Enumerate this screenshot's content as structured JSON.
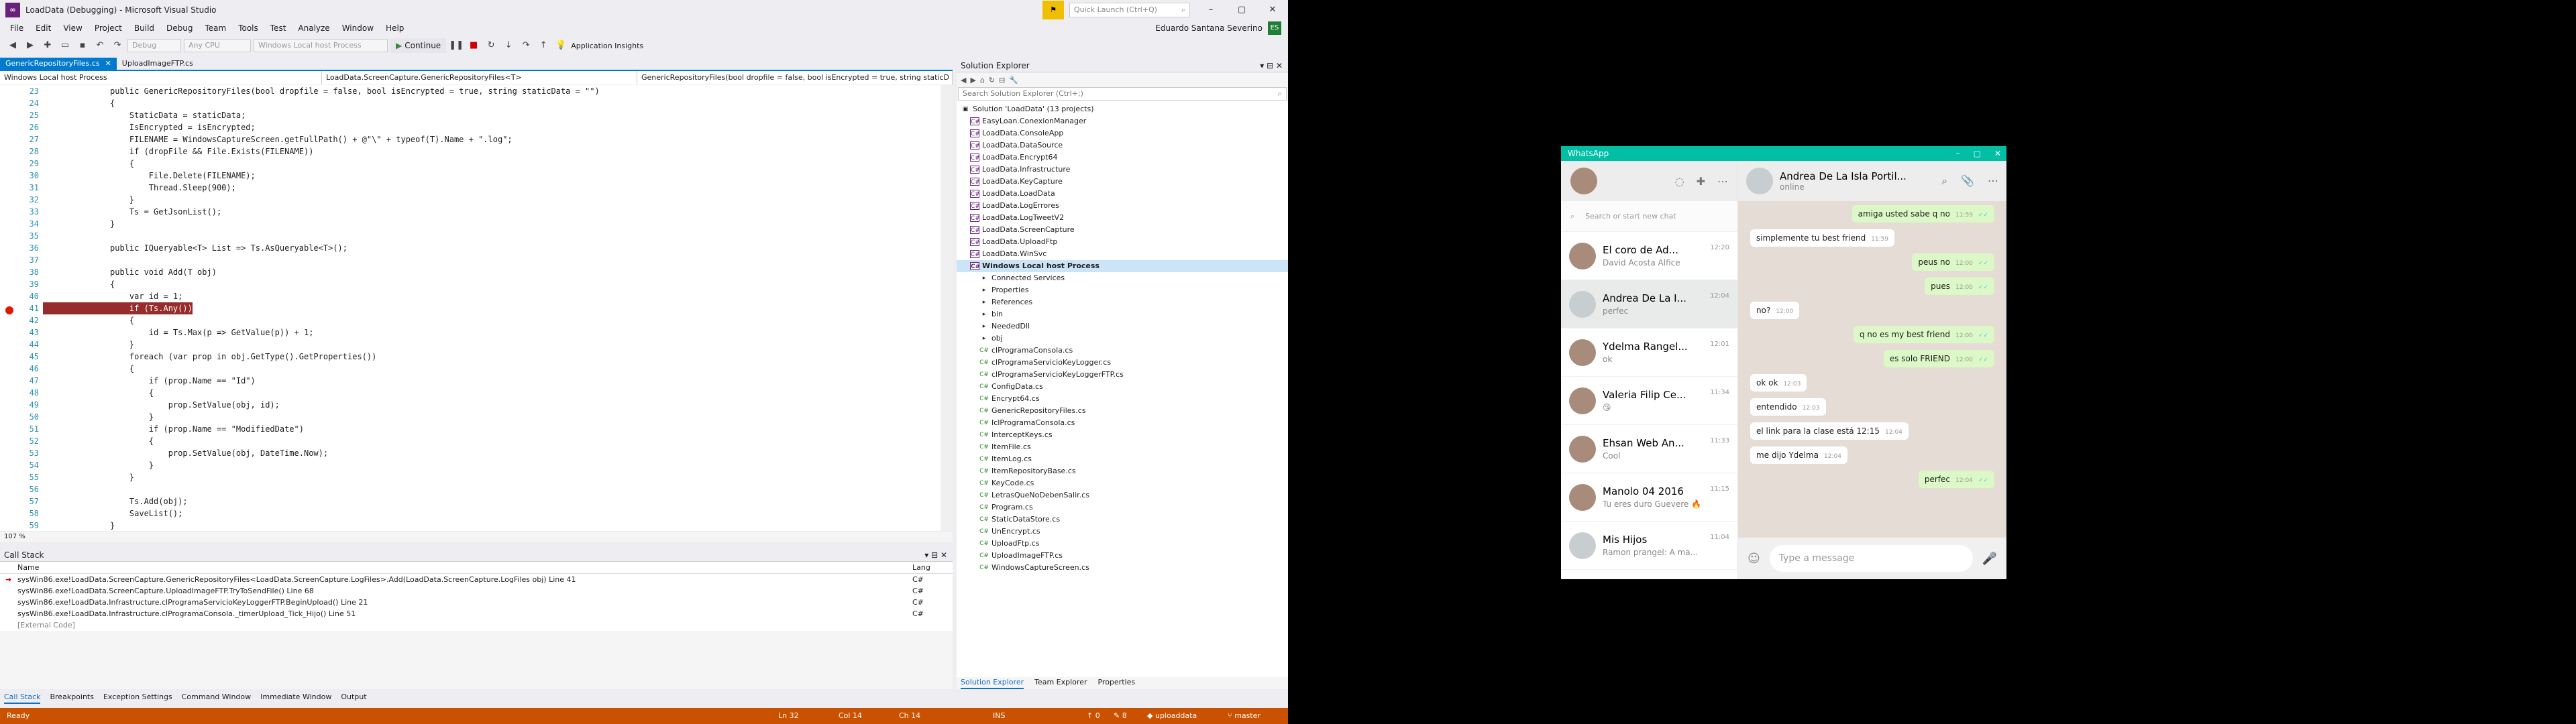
{
  "vs": {
    "title": "LoadData (Debugging) - Microsoft Visual Studio",
    "quick_launch": "Quick Launch (Ctrl+Q)",
    "account": "Eduardo Santana Severino",
    "account_initials": "ES",
    "menu": [
      "File",
      "Edit",
      "View",
      "Project",
      "Build",
      "Debug",
      "Team",
      "Tools",
      "Test",
      "Analyze",
      "Window",
      "Help"
    ],
    "toolbar": {
      "config": "Debug",
      "platform": "Any CPU",
      "process": "Windows Local host Process",
      "continue": "Continue",
      "app_insights": "Application Insights"
    },
    "tabs": [
      {
        "label": "GenericRepositoryFiles.cs"
      },
      {
        "label": "UploadImageFTP.cs"
      }
    ],
    "nav": {
      "project": "Windows Local host Process",
      "class": "LoadData.ScreenCapture.GenericRepositoryFiles<T>",
      "member": "GenericRepositoryFiles(bool dropfile = false, bool isEncrypted = true, string staticD"
    },
    "zoom": "107 %",
    "code": [
      {
        "n": "23",
        "t": "public GenericRepositoryFiles(bool dropfile = false, bool isEncrypted = true, string staticData = \"\")"
      },
      {
        "n": "24",
        "t": "{"
      },
      {
        "n": "25",
        "t": "    StaticData = staticData;"
      },
      {
        "n": "26",
        "t": "    IsEncrypted = isEncrypted;"
      },
      {
        "n": "27",
        "t": "    FILENAME = WindowsCaptureScreen.getFullPath() + @\"\\\" + typeof(T).Name + \".log\";"
      },
      {
        "n": "28",
        "t": "    if (dropFile && File.Exists(FILENAME))"
      },
      {
        "n": "29",
        "t": "    {"
      },
      {
        "n": "30",
        "t": "        File.Delete(FILENAME);"
      },
      {
        "n": "31",
        "t": "        Thread.Sleep(900);"
      },
      {
        "n": "32",
        "t": "    }"
      },
      {
        "n": "33",
        "t": "    Ts = GetJsonList();"
      },
      {
        "n": "34",
        "t": "}"
      },
      {
        "n": "35",
        "t": ""
      },
      {
        "n": "36",
        "t": "public IQueryable<T> List => Ts.AsQueryable<T>();"
      },
      {
        "n": "37",
        "t": ""
      },
      {
        "n": "38",
        "t": "public void Add(T obj)"
      },
      {
        "n": "39",
        "t": "{"
      },
      {
        "n": "40",
        "t": "    var id = 1;"
      },
      {
        "n": "41",
        "t": "    if (Ts.Any())"
      },
      {
        "n": "42",
        "t": "    {"
      },
      {
        "n": "43",
        "t": "        id = Ts.Max(p => GetValue(p)) + 1;"
      },
      {
        "n": "44",
        "t": "    }"
      },
      {
        "n": "45",
        "t": "    foreach (var prop in obj.GetType().GetProperties())"
      },
      {
        "n": "46",
        "t": "    {"
      },
      {
        "n": "47",
        "t": "        if (prop.Name == \"Id\")"
      },
      {
        "n": "48",
        "t": "        {"
      },
      {
        "n": "49",
        "t": "            prop.SetValue(obj, id);"
      },
      {
        "n": "50",
        "t": "        }"
      },
      {
        "n": "51",
        "t": "        if (prop.Name == \"ModifiedDate\")"
      },
      {
        "n": "52",
        "t": "        {"
      },
      {
        "n": "53",
        "t": "            prop.SetValue(obj, DateTime.Now);"
      },
      {
        "n": "54",
        "t": "        }"
      },
      {
        "n": "55",
        "t": "    }"
      },
      {
        "n": "56",
        "t": ""
      },
      {
        "n": "57",
        "t": "    Ts.Add(obj);"
      },
      {
        "n": "58",
        "t": "    SaveList();"
      },
      {
        "n": "59",
        "t": "}"
      }
    ],
    "callstack": {
      "title": "Call Stack",
      "col_name": "Name",
      "col_lang": "Lang",
      "rows": [
        {
          "name": "sysWin86.exe!LoadData.ScreenCapture.GenericRepositoryFiles<LoadData.ScreenCapture.LogFiles>.Add(LoadData.ScreenCapture.LogFiles obj) Line 41",
          "lang": "C#"
        },
        {
          "name": "sysWin86.exe!LoadData.ScreenCapture.UploadImageFTP.TryToSendFile() Line 68",
          "lang": "C#"
        },
        {
          "name": "sysWin86.exe!LoadData.Infrastructure.clProgramaServicioKeyLoggerFTP.BeginUpload() Line 21",
          "lang": "C#"
        },
        {
          "name": "sysWin86.exe!LoadData.Infrastructure.clProgramaConsola._timerUpload_Tick_Hijo() Line 51",
          "lang": "C#"
        },
        {
          "name": "[External Code]",
          "lang": ""
        }
      ]
    },
    "bottom_tabs": [
      "Call Stack",
      "Breakpoints",
      "Exception Settings",
      "Command Window",
      "Immediate Window",
      "Output"
    ],
    "solution_explorer": {
      "title": "Solution Explorer",
      "search": "Search Solution Explorer (Ctrl+;)",
      "items": [
        {
          "label": "Solution 'LoadData' (13 projects)",
          "kind": "sol"
        },
        {
          "label": "EasyLoan.ConexionManager",
          "kind": "proj"
        },
        {
          "label": "LoadData.ConsoleApp",
          "kind": "proj"
        },
        {
          "label": "LoadData.DataSource",
          "kind": "proj"
        },
        {
          "label": "LoadData.Encrypt64",
          "kind": "proj"
        },
        {
          "label": "LoadData.Infrastructure",
          "kind": "proj"
        },
        {
          "label": "LoadData.KeyCapture",
          "kind": "proj"
        },
        {
          "label": "LoadData.LoadData",
          "kind": "proj"
        },
        {
          "label": "LoadData.LogErrores",
          "kind": "proj"
        },
        {
          "label": "LoadData.LogTweetV2",
          "kind": "proj"
        },
        {
          "label": "LoadData.ScreenCapture",
          "kind": "proj"
        },
        {
          "label": "LoadData.UploadFtp",
          "kind": "proj"
        },
        {
          "label": "LoadData.WinSvc",
          "kind": "proj"
        },
        {
          "label": "Windows Local host Process",
          "kind": "sel"
        },
        {
          "label": "Connected Services",
          "kind": "node"
        },
        {
          "label": "Properties",
          "kind": "node"
        },
        {
          "label": "References",
          "kind": "node"
        },
        {
          "label": "bin",
          "kind": "node"
        },
        {
          "label": "NeededDll",
          "kind": "node"
        },
        {
          "label": "obj",
          "kind": "node"
        },
        {
          "label": "clProgramaConsola.cs",
          "kind": "file"
        },
        {
          "label": "clProgramaServicioKeyLogger.cs",
          "kind": "file"
        },
        {
          "label": "clProgramaServicioKeyLoggerFTP.cs",
          "kind": "file"
        },
        {
          "label": "ConfigData.cs",
          "kind": "file"
        },
        {
          "label": "Encrypt64.cs",
          "kind": "file"
        },
        {
          "label": "GenericRepositoryFiles.cs",
          "kind": "file"
        },
        {
          "label": "IclProgramaConsola.cs",
          "kind": "file"
        },
        {
          "label": "InterceptKeys.cs",
          "kind": "file"
        },
        {
          "label": "ItemFile.cs",
          "kind": "file"
        },
        {
          "label": "ItemLog.cs",
          "kind": "file"
        },
        {
          "label": "ItemRepositoryBase.cs",
          "kind": "file"
        },
        {
          "label": "KeyCode.cs",
          "kind": "file"
        },
        {
          "label": "LetrasQueNoDebenSalir.cs",
          "kind": "file"
        },
        {
          "label": "Program.cs",
          "kind": "file"
        },
        {
          "label": "StaticDataStore.cs",
          "kind": "file"
        },
        {
          "label": "UnEncrypt.cs",
          "kind": "file"
        },
        {
          "label": "UploadFtp.cs",
          "kind": "file"
        },
        {
          "label": "UploadImageFTP.cs",
          "kind": "file"
        },
        {
          "label": "WindowsCaptureScreen.cs",
          "kind": "file"
        }
      ],
      "tabs": [
        "Solution Explorer",
        "Team Explorer",
        "Properties"
      ]
    },
    "status": {
      "ready": "Ready",
      "ln": "Ln 32",
      "col": "Col 14",
      "ch": "Ch 14",
      "ins": "INS",
      "up": "0",
      "pen": "8",
      "repo": "uploaddata",
      "branch": "master"
    }
  },
  "whatsapp": {
    "title": "WhatsApp",
    "search_placeholder": "Search or start new chat",
    "chats": [
      {
        "name": "El coro de Ad...",
        "time": "12:20",
        "preview": "David Acosta Alfice"
      },
      {
        "name": "Andrea De La I...",
        "time": "12:04",
        "preview": "perfec"
      },
      {
        "name": "Ydelma Rangel...",
        "time": "12:01",
        "preview": "ok"
      },
      {
        "name": "Valeria Filip Ce...",
        "time": "11:34",
        "preview": "😘"
      },
      {
        "name": "Ehsan Web An...",
        "time": "11:33",
        "preview": "Cool"
      },
      {
        "name": "Manolo 04 2016",
        "time": "11:15",
        "preview": "Tu eres duro Guevere 🔥"
      },
      {
        "name": "Mis Hijos",
        "time": "11:04",
        "preview": "Ramon prangel: A ma..."
      }
    ],
    "active_chat": {
      "name": "Andrea De La Isla Portil...",
      "status": "online"
    },
    "messages": [
      {
        "text": "amiga usted sabe q no",
        "time": "11:59",
        "dir": "out"
      },
      {
        "text": "simplemente tu best friend",
        "time": "11:59",
        "dir": "in"
      },
      {
        "text": "peus no",
        "time": "12:00",
        "dir": "out"
      },
      {
        "text": "pues",
        "time": "12:00",
        "dir": "out"
      },
      {
        "text": "no?",
        "time": "12:00",
        "dir": "in"
      },
      {
        "text": "q no es my best friend",
        "time": "12:00",
        "dir": "out"
      },
      {
        "text": "es solo FRIEND",
        "time": "12:00",
        "dir": "out"
      },
      {
        "text": "ok ok",
        "time": "12:03",
        "dir": "in"
      },
      {
        "text": "entendido",
        "time": "12:03",
        "dir": "in"
      },
      {
        "text": "el link para la clase está 12:15",
        "time": "12:04",
        "dir": "in"
      },
      {
        "text": "me dijo Ydelma",
        "time": "12:04",
        "dir": "in"
      },
      {
        "text": "perfec",
        "time": "12:04",
        "dir": "out"
      }
    ],
    "input_placeholder": "Type a message"
  }
}
